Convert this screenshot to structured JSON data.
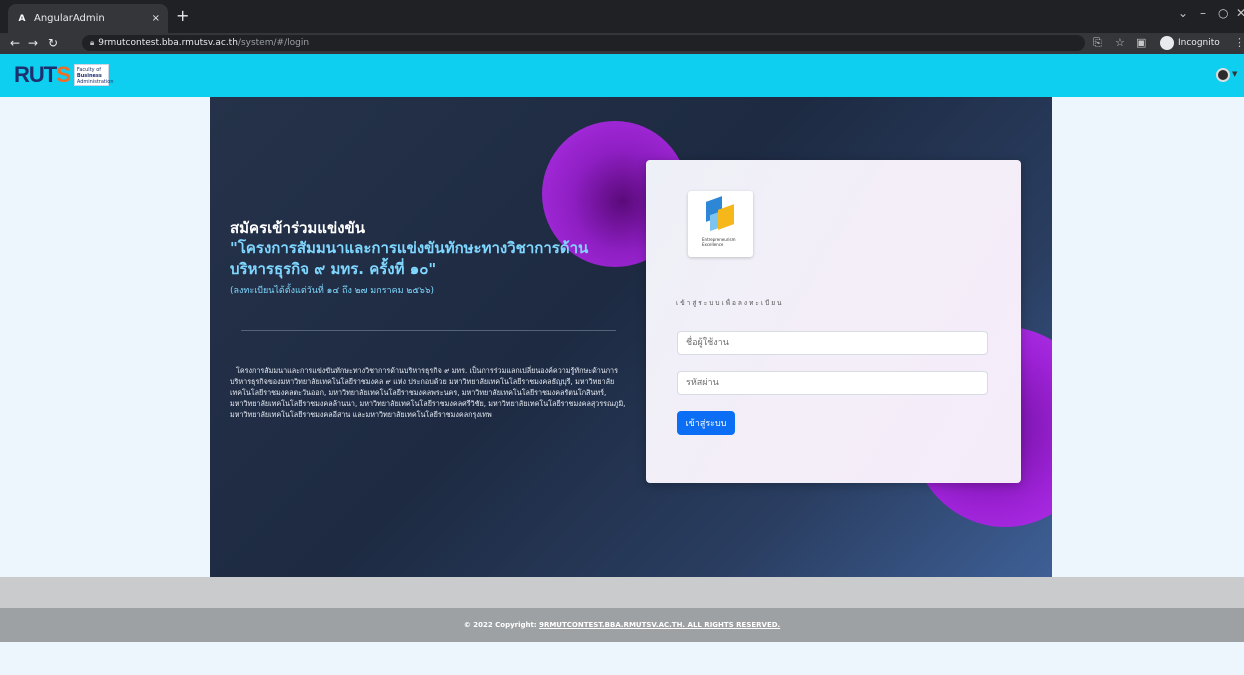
{
  "browser": {
    "tab_title": "AngularAdmin",
    "tab_favicon": "A",
    "tab_close": "×",
    "new_tab": "+",
    "url_host": "9rmutcontest.bba.rmutsv.ac.th",
    "url_path": "/system/#/login",
    "incognito_label": "Incognito",
    "icons": [
      "back-icon",
      "forward-icon",
      "reload-icon",
      "lock-icon",
      "translate-icon",
      "star-icon",
      "sidepanel-icon",
      "incognito-icon",
      "menu-icon"
    ]
  },
  "header": {
    "logo_text_a": "RUT",
    "logo_text_b": "S",
    "faculty_line1": "Faculty of",
    "faculty_line2": "Business",
    "faculty_line3": "Administration"
  },
  "hero": {
    "title_line1": "สมัครเข้าร่วมแข่งขัน",
    "title_line2": "\"โครงการสัมมนาและการแข่งขันทักษะทางวิชาการด้านบริหารธุรกิจ ๙ มทร. ครั้งที่ ๑๐\"",
    "registration_period": "(ลงทะเบียนได้ตั้งแต่วันที่ ๑๔ ถึง ๒๗ มกราคม ๒๕๖๖)",
    "description": "โครงการสัมมนาและการแข่งขันทักษะทางวิชาการด้านบริหารธุรกิจ ๙ มทร. เป็นการร่วมแลกเปลี่ยนองค์ความรู้ทักษะด้านการบริหารธุรกิจของมหาวิทยาลัยเทคโนโลยีราชมงคล ๙ แห่ง ประกอบด้วย มหาวิทยาลัยเทคโนโลยีราชมงคลธัญบุรี, มหาวิทยาลัยเทคโนโลยีราชมงคลตะวันออก, มหาวิทยาลัยเทคโนโลยีราชมงคลพระนคร, มหาวิทยาลัยเทคโนโลยีราชมงคลรัตนโกสินทร์, มหาวิทยาลัยเทคโนโลยีราชมงคลล้านนา, มหาวิทยาลัยเทคโนโลยีราชมงคลศรีวิชัย, มหาวิทยาลัยเทคโนโลยีราชมงคลสุวรรณภูมิ, มหาวิทยาลัยเทคโนโลยีราชมงคลอีสาน และมหาวิทยาลัยเทคโนโลยีราชมงคลกรุงเทพ"
  },
  "login": {
    "logo_line1": "Entrepreneurism",
    "logo_line2": "Excellence",
    "subtitle": "เข้าสู่ระบบเพื่อลงทะเบียน",
    "username_placeholder": "ชื่อผู้ใช้งาน",
    "password_placeholder": "รหัสผ่าน",
    "submit_label": "เข้าสู่ระบบ"
  },
  "footer": {
    "prefix": "© 2022 Copyright: ",
    "link_text": "9RMUTCONTEST.BBA.RMUTSV.AC.TH. ALL RIGHTS RESERVED."
  },
  "colors": {
    "header_bg": "#0fcff0",
    "hero_bg": "#1d2a42",
    "accent_orb": "#9d22d6",
    "button": "#0c6ef5",
    "footer_bg": "#9ea1a4"
  }
}
